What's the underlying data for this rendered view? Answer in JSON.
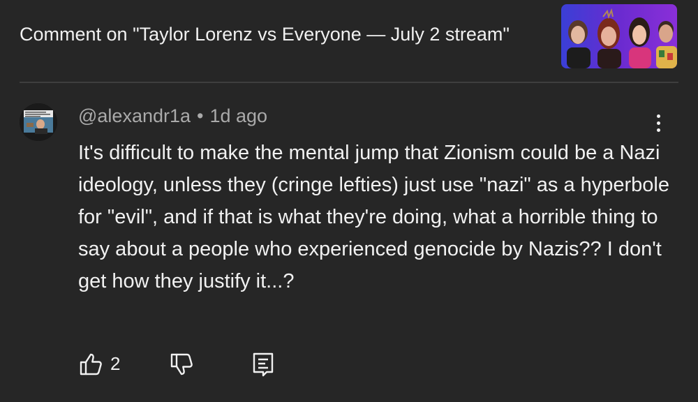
{
  "header": {
    "title": "Comment on \"Taylor Lorenz vs Everyone — July 2 stream\"",
    "thumbnail_icon": "video-thumbnail"
  },
  "comment": {
    "author": "@alexandr1a",
    "separator": "•",
    "time": "1d ago",
    "text": "It's difficult to make the mental jump that Zionism could be a Nazi ideology, unless they (cringe lefties) just use \"nazi\" as a hyperbole for \"evil\", and if that is what they're doing, what a horrible thing to say about a people who experienced genocide by Nazis?? I don't get how they justify it...?",
    "likes": "2"
  },
  "colors": {
    "background": "#262626",
    "text_primary": "#f1f1f1",
    "text_secondary": "#aaaaaa",
    "divider": "#3e3e3e"
  }
}
